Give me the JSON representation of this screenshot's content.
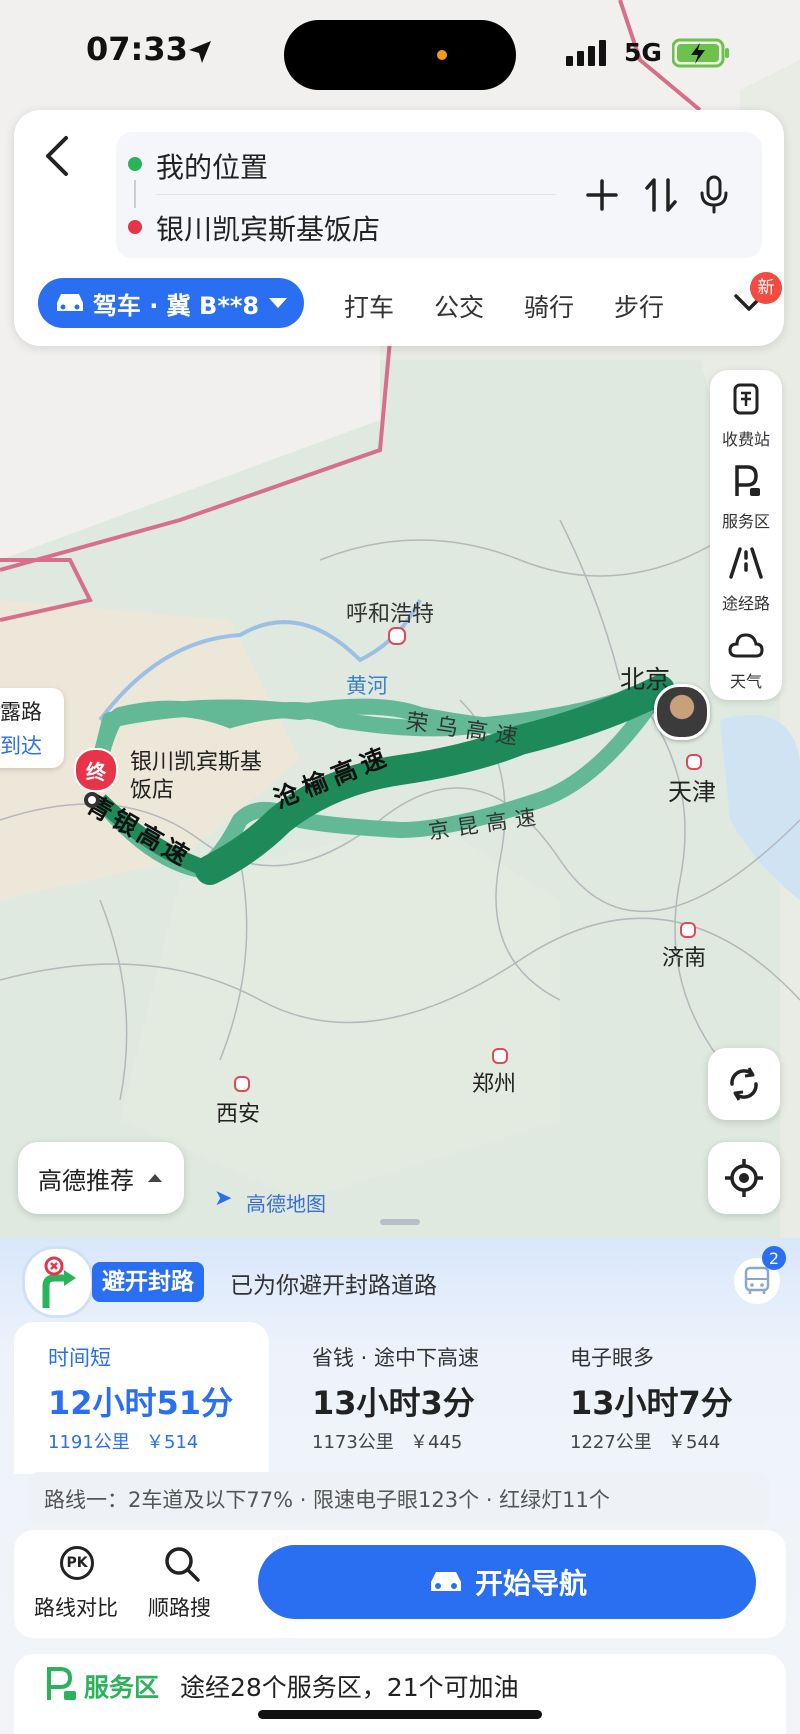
{
  "status": {
    "time": "07:33",
    "network": "5G"
  },
  "search": {
    "origin": "我的位置",
    "destination": "银川凯宾斯基饭店",
    "travel_modes": [
      "驾车 · 冀 B**8",
      "打车",
      "公交",
      "骑行",
      "步行"
    ],
    "new_badge": "新"
  },
  "map": {
    "cities": [
      "呼和浩特",
      "北京",
      "天津",
      "济南",
      "郑州",
      "西安"
    ],
    "river": "黄河",
    "highways": [
      "荣乌高速",
      "沧榆高速",
      "京昆高速",
      "青银高速"
    ],
    "dest_marker": "终",
    "dest_label_line1": "银川凯宾斯基",
    "dest_label_line2": "饭店",
    "edge_label_1": "露路",
    "edge_label_2": "到达",
    "watermark": "高德地图"
  },
  "tools": [
    {
      "label": "收费站",
      "icon": "toll-station-icon"
    },
    {
      "label": "服务区",
      "icon": "service-area-icon"
    },
    {
      "label": "途经路",
      "icon": "route-road-icon"
    },
    {
      "label": "天气",
      "icon": "weather-icon"
    }
  ],
  "recommend": "高德推荐",
  "closure": {
    "badge": "避开封路",
    "text": "已为你避开封路道路",
    "bus_count": "2"
  },
  "routes": [
    {
      "tag": "时间短",
      "time": "12小时51分",
      "distance": "1191公里",
      "cost": "￥514"
    },
    {
      "tag": "省钱 · 途中下高速",
      "time": "13小时3分",
      "distance": "1173公里",
      "cost": "￥445"
    },
    {
      "tag": "电子眼多",
      "time": "13小时7分",
      "distance": "1227公里",
      "cost": "￥544"
    }
  ],
  "route_info": "路线一：2车道及以下77% · 限速电子眼123个 · 红绿灯11个",
  "actions": {
    "compare": "路线对比",
    "along": "顺路搜",
    "start_nav": "开始导航",
    "pk": "PK"
  },
  "service": {
    "title": "服务区",
    "text": "途经28个服务区，21个可加油"
  },
  "colors": {
    "accent": "#2a6ff2",
    "route_main": "#1e8a5a",
    "route_alt": "#5fb894"
  }
}
